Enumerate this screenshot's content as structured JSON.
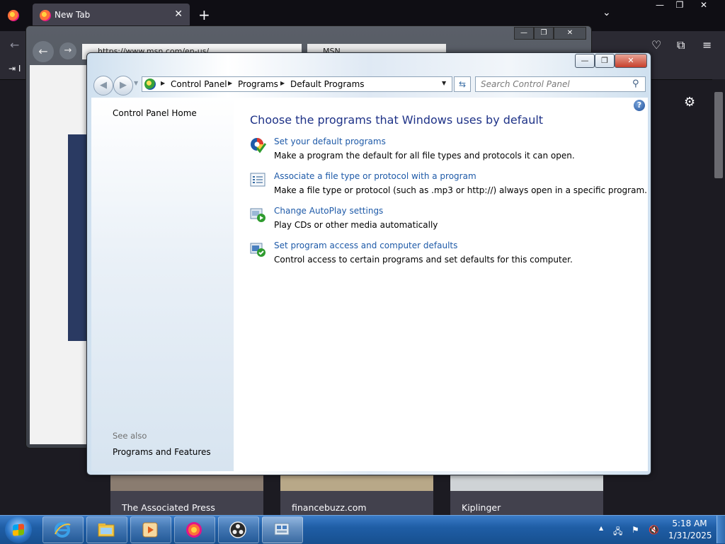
{
  "firefox": {
    "tab_title": "New Tab",
    "tab_close": "✕",
    "new_tab": "+",
    "list_tabs": "⌄",
    "win_min": "—",
    "win_restore": "❐",
    "win_close": "✕",
    "back": "←",
    "import": "⇥ I",
    "toolbar_icons": [
      "pocket-icon",
      "extensions-icon",
      "menu-icon"
    ],
    "toolbar_glyphs": [
      "♡",
      "⧉",
      "≡"
    ],
    "settings_glyph": "⚙",
    "news_cards": [
      "The Associated Press",
      "financebuzz.com",
      "Kiplinger"
    ]
  },
  "ie": {
    "back": "←",
    "forward": "→",
    "address_text": "https://www.msn.com/en-us/...",
    "tab_text": "MSN",
    "win_min": "—",
    "win_restore": "❐",
    "win_close": "✕"
  },
  "control_panel": {
    "win_min": "—",
    "win_restore": "❐",
    "win_close": "✕",
    "back_glyph": "◀",
    "fwd_glyph": "▶",
    "recent_glyph": "▼",
    "breadcrumb": [
      "Control Panel",
      "Programs",
      "Default Programs"
    ],
    "crumb_arrow": "▶",
    "addr_dropdown": "▼",
    "refresh_glyph": "⇆",
    "search_placeholder": "Search Control Panel",
    "search_glyph": "⚲",
    "help_glyph": "?",
    "sidebar": {
      "home": "Control Panel Home",
      "see_also": "See also",
      "programs_features": "Programs and Features"
    },
    "heading": "Choose the programs that Windows uses by default",
    "options": [
      {
        "link": "Set your default programs",
        "desc": "Make a program the default for all file types and protocols it can open.",
        "icon": "default-programs-icon"
      },
      {
        "link": "Associate a file type or protocol with a program",
        "desc": "Make a file type or protocol (such as .mp3 or http://) always open in a specific program.",
        "icon": "file-association-icon"
      },
      {
        "link": "Change AutoPlay settings",
        "desc": "Play CDs or other media automatically",
        "icon": "autoplay-icon"
      },
      {
        "link": "Set program access and computer defaults",
        "desc": "Control access to certain programs and set defaults for this computer.",
        "icon": "program-access-icon"
      }
    ]
  },
  "taskbar": {
    "items": [
      "internet-explorer-icon",
      "file-explorer-icon",
      "media-player-icon",
      "firefox-icon",
      "obs-icon",
      "control-panel-icon"
    ],
    "tray_up": "▲",
    "tray_icons": [
      "network-icon",
      "action-center-flag-icon",
      "volume-muted-icon"
    ],
    "tray_glyphs": [
      "🖧",
      "⚑",
      "🔇"
    ],
    "time": "5:18 AM",
    "date": "1/31/2025"
  }
}
